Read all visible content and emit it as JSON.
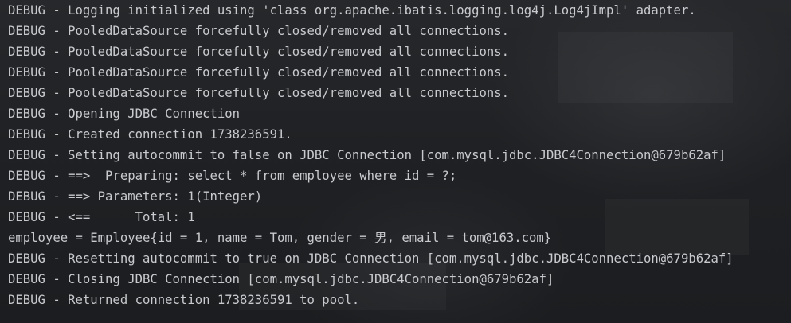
{
  "console": {
    "lines": [
      "DEBUG - Logging initialized using 'class org.apache.ibatis.logging.log4j.Log4jImpl' adapter.",
      "DEBUG - PooledDataSource forcefully closed/removed all connections.",
      "DEBUG - PooledDataSource forcefully closed/removed all connections.",
      "DEBUG - PooledDataSource forcefully closed/removed all connections.",
      "DEBUG - PooledDataSource forcefully closed/removed all connections.",
      "DEBUG - Opening JDBC Connection",
      "DEBUG - Created connection 1738236591.",
      "DEBUG - Setting autocommit to false on JDBC Connection [com.mysql.jdbc.JDBC4Connection@679b62af]",
      "DEBUG - ==>  Preparing: select * from employee where id = ?;",
      "DEBUG - ==> Parameters: 1(Integer)",
      "DEBUG - <==      Total: 1",
      "employee = Employee{id = 1, name = Tom, gender = 男, email = tom@163.com}",
      "DEBUG - Resetting autocommit to true on JDBC Connection [com.mysql.jdbc.JDBC4Connection@679b62af]",
      "DEBUG - Closing JDBC Connection [com.mysql.jdbc.JDBC4Connection@679b62af]",
      "DEBUG - Returned connection 1738236591 to pool."
    ]
  },
  "colors": {
    "background": "#1c1e21",
    "text": "#c8cacd"
  }
}
